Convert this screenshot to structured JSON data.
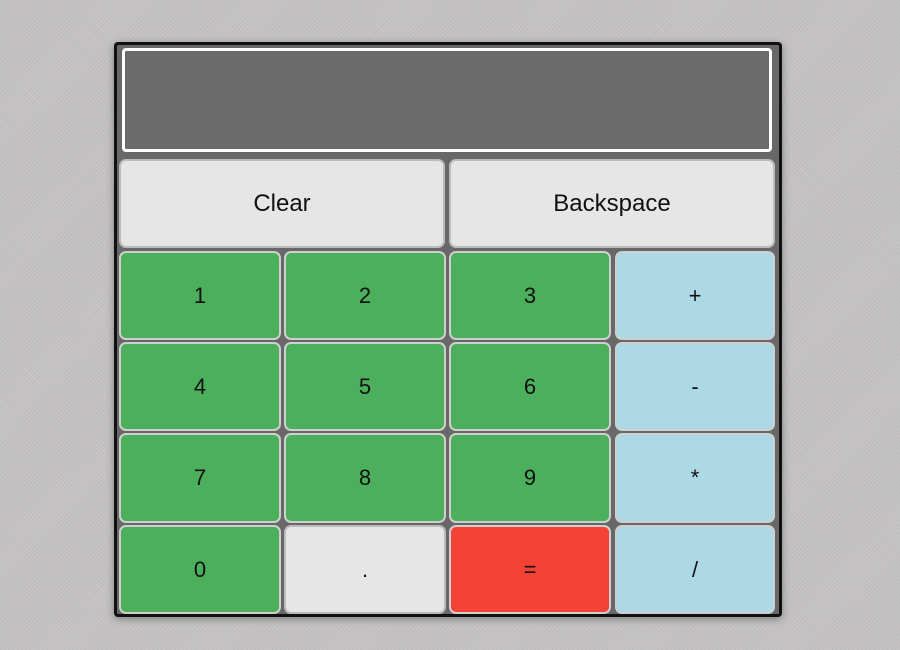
{
  "display": {
    "value": ""
  },
  "controls": {
    "clear_label": "Clear",
    "backspace_label": "Backspace"
  },
  "keys": {
    "one": "1",
    "two": "2",
    "three": "3",
    "plus": "+",
    "four": "4",
    "five": "5",
    "six": "6",
    "minus": "-",
    "seven": "7",
    "eight": "8",
    "nine": "9",
    "multiply": "*",
    "zero": "0",
    "decimal": ".",
    "equals": "=",
    "divide": "/"
  },
  "colors": {
    "number_key": "#4caf5c",
    "operator_key": "#add8e6",
    "equals_key": "#f44336",
    "utility_key": "#e6e6e6",
    "display_background": "#6b6b6b",
    "calculator_body": "#686868"
  }
}
